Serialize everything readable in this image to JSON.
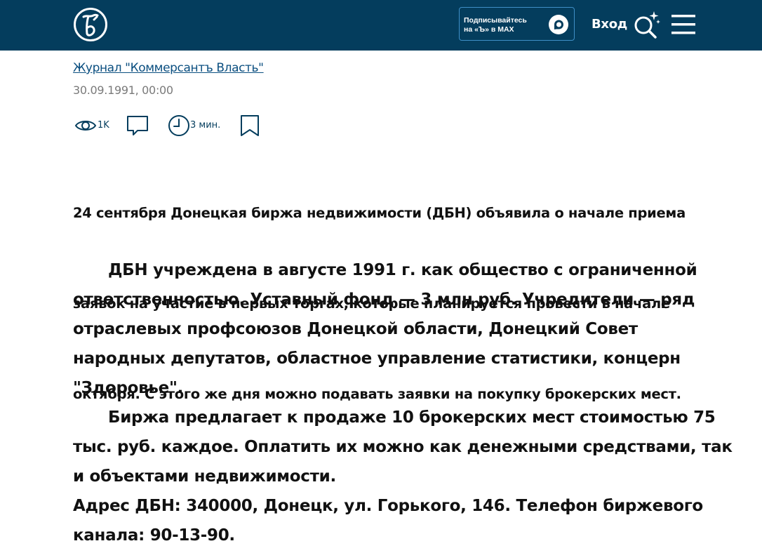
{
  "header": {
    "logo_icon": "kommersant-logo-icon",
    "subscribe_line1": "Подписывайтесь",
    "subscribe_line2": "на «Ъ» в MAX",
    "login_label": "Вход",
    "colors": {
      "bar": "#043d5d",
      "accent": "#3f8fc7"
    }
  },
  "article": {
    "source_link": "Журнал \"Коммерсантъ Власть\"",
    "date": "30.09.1991, 00:00",
    "views": "1K",
    "read_time": "3 мин.",
    "lead_lines": [
      "  24 сентября Донецкая биржа недвижимости (ДБН) объявила о начале приема",
      "заявок на участие в первых торгах, которые планируется провести в начале",
      "октября. С этого же дня можно подавать заявки на покупку брокерских мест."
    ],
    "paragraph1_lines": [
      "ДБН учреждена в августе 1991 г. как общество с ограниченной",
      "ответственностью. Уставный фонд — 3 млн руб. Учредители — ряд",
      "отраслевых профсоюзов Донецкой области, Донецкий Совет",
      "народных депутатов, областное управление статистики, концерн",
      "\"Здоровье\"."
    ],
    "paragraph2_lines": [
      "Биржа предлагает к продаже 10 брокерских мест стоимостью 75",
      "тыс. руб. каждое. Оплатить их можно как денежными средствами, так",
      "и объектами недвижимости."
    ],
    "paragraph3_lines": [
      "Адрес ДБН: 340000, Донецк, ул. Горького, 146. Телефон биржевого",
      "канала: 90-13-90."
    ]
  }
}
